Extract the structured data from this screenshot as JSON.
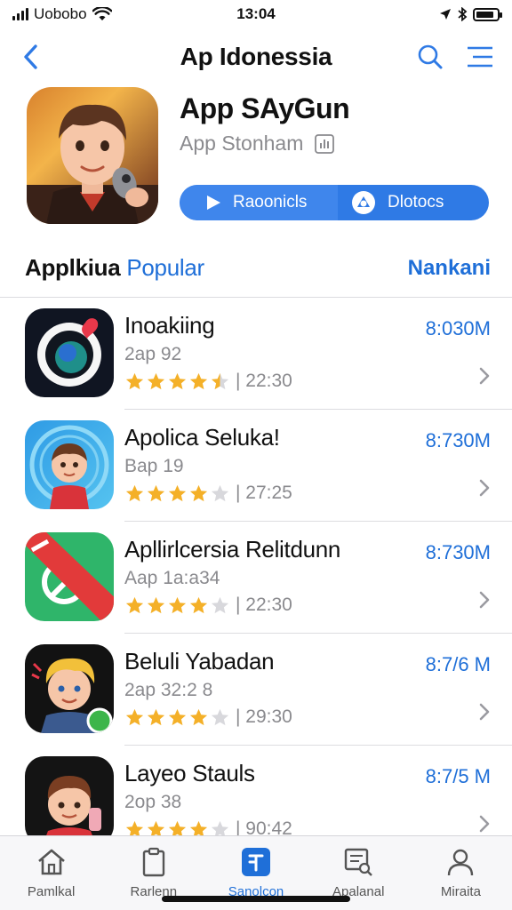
{
  "status_bar": {
    "carrier": "Uobobo",
    "time": "13:04",
    "battery_level": 0.85
  },
  "nav": {
    "title": "Ap Idonessia"
  },
  "featured": {
    "name": "App SAyGun",
    "subtitle": "App Stonham",
    "primary_action": "Raoonicls",
    "secondary_action": "Dlotocs"
  },
  "section": {
    "title_bold": "Applkiua",
    "title_accent": "Popular",
    "link": "Nankani"
  },
  "apps": [
    {
      "name": "Inoakiing",
      "subtitle": "2ap 92",
      "rating": 4.5,
      "meta": "22:30",
      "size": "8:030M"
    },
    {
      "name": "Apolica Seluka!",
      "subtitle": "Bap 19",
      "rating": 4,
      "meta": "27:25",
      "size": "8:730M"
    },
    {
      "name": "Apllirlcersia Relitdunn",
      "subtitle": "Aap 1a:a34",
      "rating": 4,
      "meta": "22:30",
      "size": "8:730M"
    },
    {
      "name": "Beluli Yabadan",
      "subtitle": "2ap 32:2 8",
      "rating": 4,
      "meta": "29:30",
      "size": "8:7/6 M"
    },
    {
      "name": "Layeo Stauls",
      "subtitle": "2op 38",
      "rating": 4,
      "meta": "90:42",
      "size": "8:7/5 M"
    }
  ],
  "tabs": [
    {
      "label": "Pamlkal",
      "icon": "home-icon",
      "active": false
    },
    {
      "label": "Rarlenn",
      "icon": "clipboard-icon",
      "active": false
    },
    {
      "label": "Sanolcon",
      "icon": "apps-icon",
      "active": true
    },
    {
      "label": "Apalanal",
      "icon": "search-document-icon",
      "active": false
    },
    {
      "label": "Miraita",
      "icon": "person-icon",
      "active": false
    }
  ],
  "colors": {
    "accent": "#1f6fd8",
    "star": "#f4b028",
    "star_empty": "#d8d8dc"
  }
}
